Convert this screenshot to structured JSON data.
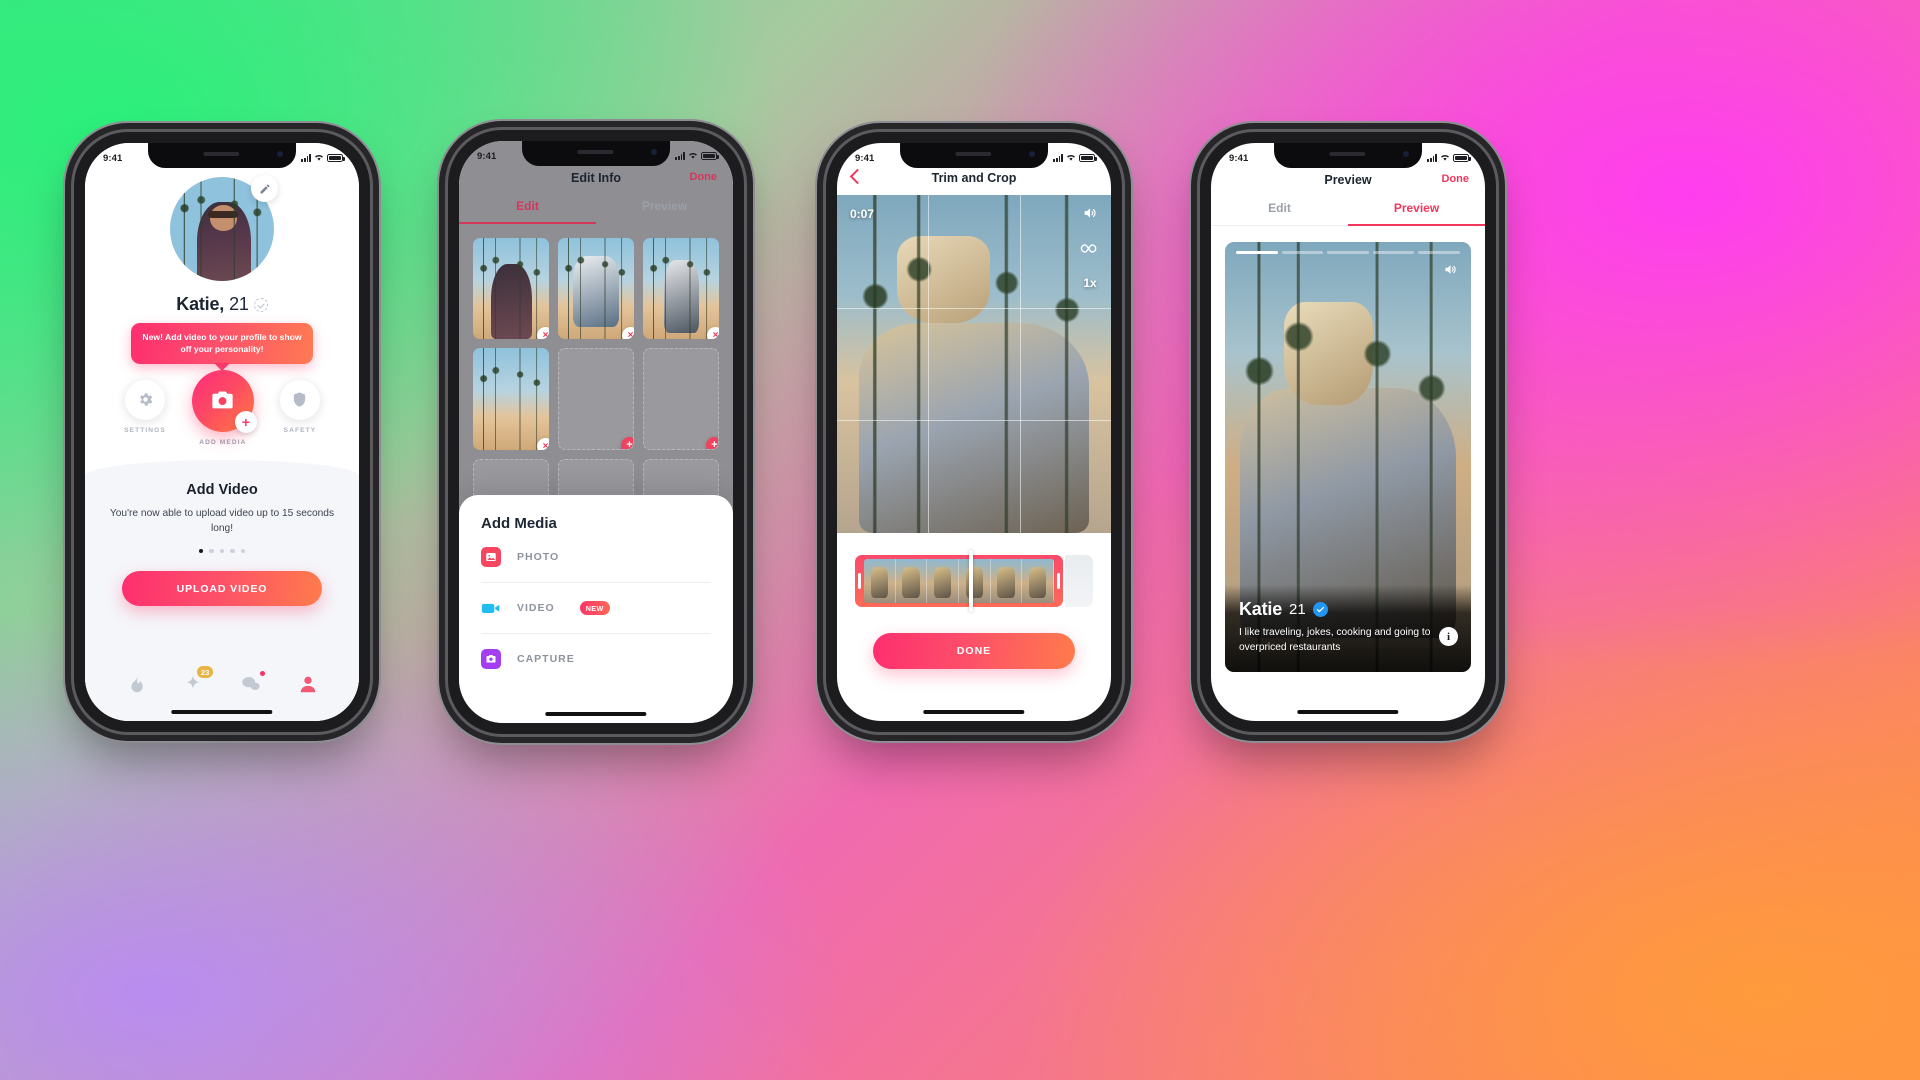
{
  "status_bar": {
    "time": "9:41"
  },
  "phone1": {
    "name": "Katie",
    "age": "21",
    "name_separator": ",",
    "tooltip": "New! Add video to your profile to show off your personality!",
    "actions": [
      {
        "label": "SETTINGS",
        "icon": "gear-icon"
      },
      {
        "label": "ADD MEDIA",
        "icon": "camera-icon"
      },
      {
        "label": "SAFETY",
        "icon": "shield-icon"
      }
    ],
    "card": {
      "title": "Add Video",
      "body": "You're now able to upload video up to 15 seconds long!",
      "dots_total": 5,
      "dots_active": 1,
      "cta": "UPLOAD VIDEO"
    },
    "tabbar": [
      {
        "icon": "flame-icon",
        "badge": ""
      },
      {
        "icon": "star-icon",
        "badge": "23"
      },
      {
        "icon": "chat-icon",
        "badge": "dot"
      },
      {
        "icon": "profile-icon",
        "badge": ""
      }
    ]
  },
  "phone2": {
    "title": "Edit Info",
    "done": "Done",
    "tabs": [
      {
        "label": "Edit",
        "active": true
      },
      {
        "label": "Preview",
        "active": false
      }
    ],
    "sheet": {
      "title": "Add Media",
      "items": [
        {
          "label": "PHOTO",
          "icon": "photo-icon",
          "color": "#f5455f",
          "badge": ""
        },
        {
          "label": "VIDEO",
          "icon": "video-icon",
          "color": "#22bdf0",
          "badge": "NEW"
        },
        {
          "label": "CAPTURE",
          "icon": "capture-icon",
          "color": "#a33ff0",
          "badge": ""
        }
      ]
    }
  },
  "phone3": {
    "title": "Trim and Crop",
    "back_icon": "chevron-left-icon",
    "timer": "0:07",
    "controls": [
      {
        "icon": "speaker-icon",
        "label": ""
      },
      {
        "icon": "loop-icon",
        "label": ""
      },
      {
        "icon": "speed-icon",
        "label": "1x"
      }
    ],
    "done": "DONE"
  },
  "phone4": {
    "title": "Preview",
    "done": "Done",
    "tabs": [
      {
        "label": "Edit",
        "active": false
      },
      {
        "label": "Preview",
        "active": true
      }
    ],
    "profile": {
      "name": "Katie",
      "age": "21",
      "verified_icon": "blue-check-icon",
      "bio": "I like traveling, jokes, cooking and going to overpriced restaurants",
      "info_icon": "info-icon"
    },
    "progress_total": 5,
    "progress_active": 1
  },
  "colors": {
    "accent_pink": "#fd2f6e",
    "accent_orange": "#ff7b4b",
    "blue_check": "#2196f3"
  }
}
